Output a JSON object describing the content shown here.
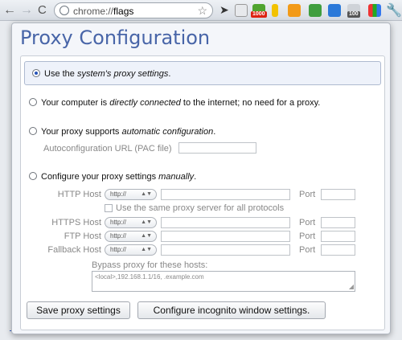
{
  "browser": {
    "url_prefix": "chrome://",
    "url_path": "flags",
    "back_icon": "←",
    "forward_icon": "→",
    "reload_icon": "C",
    "star_icon": "☆",
    "wrench_icon": "🔧",
    "extension_badges": [
      "1000",
      "100"
    ]
  },
  "dialog": {
    "title": "Proxy Configuration",
    "options": {
      "system": {
        "pre": "Use the ",
        "em": "system's proxy settings",
        "post": "."
      },
      "direct": {
        "pre": "Your computer is ",
        "em": "directly connected",
        "post": " to the internet; no need for a proxy."
      },
      "auto": {
        "pre": "Your proxy supports ",
        "em": "automatic configuration",
        "post": "."
      },
      "manual": {
        "pre": "Configure your proxy settings ",
        "em": "manually",
        "post": "."
      }
    },
    "autoconfig_label": "Autoconfiguration URL (PAC file)",
    "hosts": [
      {
        "label": "HTTP Host",
        "scheme": "http://",
        "port_label": "Port"
      },
      {
        "label": "HTTPS Host",
        "scheme": "http://",
        "port_label": "Port"
      },
      {
        "label": "FTP Host",
        "scheme": "http://",
        "port_label": "Port"
      },
      {
        "label": "Fallback Host",
        "scheme": "http://",
        "port_label": "Port"
      }
    ],
    "same_proxy_label": "Use the same proxy server for all protocols",
    "bypass_label": "Bypass proxy for these hosts:",
    "bypass_value": "<local>,192.168.1.1/16, .example.com",
    "buttons": {
      "save": "Save proxy settings",
      "incognito": "Configure incognito window settings."
    }
  },
  "colors": {
    "title": "#4865a8",
    "selected_bg": "#eef2fa"
  }
}
